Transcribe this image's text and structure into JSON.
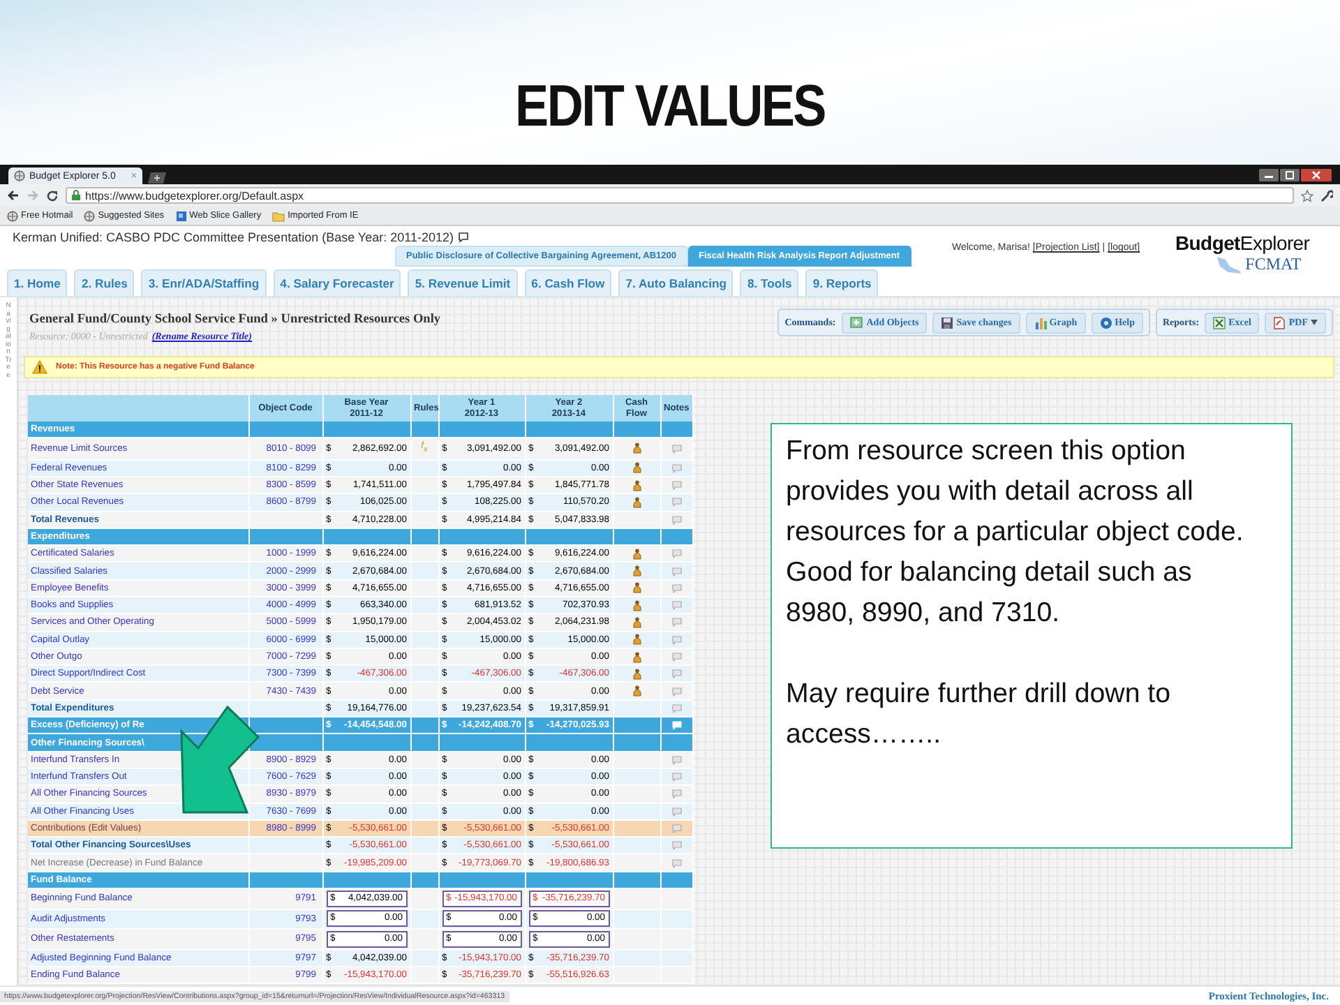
{
  "slide": {
    "title": "EDIT VALUES"
  },
  "browser": {
    "tab_title": "Budget Explorer 5.0",
    "tab_close": "×",
    "url": "https://www.budgetexplorer.org/Default.aspx",
    "bookmarks": [
      "Free Hotmail",
      "Suggested Sites",
      "Web Slice Gallery",
      "Imported From IE"
    ],
    "status_url": "https://www.budgetexplorer.org/Projection/ResView/Contributions.aspx?group_id=15&returnurl=/Projection/ResView/IndividualResource.aspx?id=463313"
  },
  "app": {
    "project_title": "Kerman Unified: CASBO PDC Committee Presentation (Base Year: 2011-2012)",
    "sub_tabs": [
      {
        "label": "Public Disclosure of Collective Bargaining Agreement, AB1200",
        "selected": false
      },
      {
        "label": "Fiscal Health Risk Analysis Report Adjustment",
        "selected": true
      }
    ],
    "welcome": "Welcome, Marisa!",
    "links": [
      "[Projection List]",
      "[logout]"
    ],
    "separator": "|",
    "logo": {
      "name": "**Budget**Explorer",
      "sub": "FCMAT"
    },
    "nav_tabs": [
      "1. Home",
      "2. Rules",
      "3. Enr/ADA/Staffing",
      "4. Salary Forecaster",
      "5. Revenue Limit",
      "6. Cash Flow",
      "7. Auto Balancing",
      "8. Tools",
      "9. Reports"
    ],
    "side_label": "Navigation Tree",
    "page_title": "General Fund/County School Service Fund » Unrestricted Resources Only",
    "resource": "Resource: 0000 - Unrestricted",
    "rename_link": "(Rename Resource Title)",
    "commands": {
      "label": "Commands:",
      "buttons": [
        {
          "label": "Add Objects"
        },
        {
          "label": "Save changes"
        },
        {
          "label": "Graph"
        },
        {
          "label": "Help"
        }
      ]
    },
    "reports": {
      "label": "Reports:",
      "buttons": [
        {
          "label": "Excel",
          "dropdown": false
        },
        {
          "label": "PDF",
          "dropdown": true
        }
      ]
    },
    "note": "Note: This Resource has a negative Fund Balance"
  },
  "table": {
    "columns": [
      "Object Code",
      "Base Year\n2011-12",
      "Rules",
      "Year 1\n2012-13",
      "Year 2\n2013-14",
      "Cash Flow",
      "Notes"
    ],
    "rows": [
      {
        "kind": "section",
        "label": "Revenues"
      },
      {
        "kind": "item",
        "label": "Revenue Limit Sources",
        "code": "8010 - 8099",
        "values": [
          [
            "$",
            "2,862,692.00"
          ],
          [
            "$",
            "3,091,492.00"
          ],
          [
            "$",
            "3,091,492.00"
          ]
        ],
        "red": [
          false,
          false,
          false
        ],
        "rule": "f$_{x}$",
        "cash_flow": true,
        "notes": true
      },
      {
        "kind": "item",
        "label": "Federal Revenues",
        "code": "8100 - 8299",
        "values": [
          [
            "$",
            "0.00"
          ],
          [
            "$",
            "0.00"
          ],
          [
            "$",
            "0.00"
          ]
        ],
        "red": [
          false,
          false,
          false
        ],
        "cash_flow": true,
        "notes": true
      },
      {
        "kind": "item",
        "label": "Other State Revenues",
        "code": "8300 - 8599",
        "values": [
          [
            "$",
            "1,741,511.00"
          ],
          [
            "$",
            "1,795,497.84"
          ],
          [
            "$",
            "1,845,771.78"
          ]
        ],
        "red": [
          false,
          false,
          false
        ],
        "cash_flow": true,
        "notes": true
      },
      {
        "kind": "item",
        "label": "Other Local Revenues",
        "code": "8600 - 8799",
        "values": [
          [
            "$",
            "106,025.00"
          ],
          [
            "$",
            "108,225.00"
          ],
          [
            "$",
            "110,570.20"
          ]
        ],
        "red": [
          false,
          false,
          false
        ],
        "cash_flow": true,
        "notes": true
      },
      {
        "kind": "total",
        "label": "Total Revenues",
        "values": [
          [
            "$",
            "4,710,228.00"
          ],
          [
            "$",
            "4,995,214.84"
          ],
          [
            "$",
            "5,047,833.98"
          ]
        ],
        "red": [
          false,
          false,
          false
        ],
        "cash_flow": false,
        "notes": true
      },
      {
        "kind": "section",
        "label": "Expenditures"
      },
      {
        "kind": "item",
        "label": "Certificated Salaries",
        "code": "1000 - 1999",
        "values": [
          [
            "$",
            "9,616,224.00"
          ],
          [
            "$",
            "9,616,224.00"
          ],
          [
            "$",
            "9,616,224.00"
          ]
        ],
        "red": [
          false,
          false,
          false
        ],
        "cash_flow": true,
        "notes": true
      },
      {
        "kind": "item",
        "label": "Classified Salaries",
        "code": "2000 - 2999",
        "values": [
          [
            "$",
            "2,670,684.00"
          ],
          [
            "$",
            "2,670,684.00"
          ],
          [
            "$",
            "2,670,684.00"
          ]
        ],
        "red": [
          false,
          false,
          false
        ],
        "cash_flow": true,
        "notes": true
      },
      {
        "kind": "item",
        "label": "Employee Benefits",
        "code": "3000 - 3999",
        "values": [
          [
            "$",
            "4,716,655.00"
          ],
          [
            "$",
            "4,716,655.00"
          ],
          [
            "$",
            "4,716,655.00"
          ]
        ],
        "red": [
          false,
          false,
          false
        ],
        "cash_flow": true,
        "notes": true
      },
      {
        "kind": "item",
        "label": "Books and Supplies",
        "code": "4000 - 4999",
        "values": [
          [
            "$",
            "663,340.00"
          ],
          [
            "$",
            "681,913.52"
          ],
          [
            "$",
            "702,370.93"
          ]
        ],
        "red": [
          false,
          false,
          false
        ],
        "cash_flow": true,
        "notes": true
      },
      {
        "kind": "item",
        "label": "Services and Other Operating",
        "code": "5000 - 5999",
        "values": [
          [
            "$",
            "1,950,179.00"
          ],
          [
            "$",
            "2,004,453.02"
          ],
          [
            "$",
            "2,064,231.98"
          ]
        ],
        "red": [
          false,
          false,
          false
        ],
        "cash_flow": true,
        "notes": true
      },
      {
        "kind": "item",
        "label": "Capital Outlay",
        "code": "6000 - 6999",
        "values": [
          [
            "$",
            "15,000.00"
          ],
          [
            "$",
            "15,000.00"
          ],
          [
            "$",
            "15,000.00"
          ]
        ],
        "red": [
          false,
          false,
          false
        ],
        "cash_flow": true,
        "notes": true
      },
      {
        "kind": "item",
        "label": "Other Outgo",
        "code": "7000 - 7299",
        "values": [
          [
            "$",
            "0.00"
          ],
          [
            "$",
            "0.00"
          ],
          [
            "$",
            "0.00"
          ]
        ],
        "red": [
          false,
          false,
          false
        ],
        "cash_flow": true,
        "notes": true
      },
      {
        "kind": "item",
        "label": "Direct Support/Indirect Cost",
        "code": "7300 - 7399",
        "values": [
          [
            "$",
            "-467,306.00"
          ],
          [
            "$",
            "-467,306.00"
          ],
          [
            "$",
            "-467,306.00"
          ]
        ],
        "red": [
          true,
          true,
          true
        ],
        "cash_flow": true,
        "notes": true
      },
      {
        "kind": "item",
        "label": "Debt Service",
        "code": "7430 - 7439",
        "values": [
          [
            "$",
            "0.00"
          ],
          [
            "$",
            "0.00"
          ],
          [
            "$",
            "0.00"
          ]
        ],
        "red": [
          false,
          false,
          false
        ],
        "cash_flow": true,
        "notes": true
      },
      {
        "kind": "total",
        "label": "Total Expenditures",
        "values": [
          [
            "$",
            "19,164,776.00"
          ],
          [
            "$",
            "19,237,623.54"
          ],
          [
            "$",
            "19,317,859.91"
          ]
        ],
        "red": [
          false,
          false,
          false
        ],
        "cash_flow": false,
        "notes": true
      },
      {
        "kind": "excess",
        "label": "Excess (Deficiency) of Re",
        "values": [
          [
            "$",
            "-14,454,548.00"
          ],
          [
            "$",
            "-14,242,408.70"
          ],
          [
            "$",
            "-14,270,025.93"
          ]
        ],
        "cash_flow": false,
        "notes": true
      },
      {
        "kind": "section",
        "label": "Other Financing Sources\\"
      },
      {
        "kind": "item",
        "label": "Interfund Transfers In",
        "code": "8900 - 8929",
        "values": [
          [
            "$",
            "0.00"
          ],
          [
            "$",
            "0.00"
          ],
          [
            "$",
            "0.00"
          ]
        ],
        "red": [
          false,
          false,
          false
        ],
        "cash_flow": false,
        "notes": true
      },
      {
        "kind": "item",
        "label": "Interfund Transfers Out",
        "code": "7600 - 7629",
        "values": [
          [
            "$",
            "0.00"
          ],
          [
            "$",
            "0.00"
          ],
          [
            "$",
            "0.00"
          ]
        ],
        "red": [
          false,
          false,
          false
        ],
        "cash_flow": false,
        "notes": true
      },
      {
        "kind": "item",
        "label": "All Other Financing Sources",
        "code": "8930 - 8979",
        "values": [
          [
            "$",
            "0.00"
          ],
          [
            "$",
            "0.00"
          ],
          [
            "$",
            "0.00"
          ]
        ],
        "red": [
          false,
          false,
          false
        ],
        "cash_flow": false,
        "notes": true
      },
      {
        "kind": "item",
        "label": "All Other Financing Uses",
        "code": "7630 - 7699",
        "values": [
          [
            "$",
            "0.00"
          ],
          [
            "$",
            "0.00"
          ],
          [
            "$",
            "0.00"
          ]
        ],
        "red": [
          false,
          false,
          false
        ],
        "cash_flow": false,
        "notes": true
      },
      {
        "kind": "highlight",
        "label": "Contributions (Edit Values)",
        "code": "8980 - 8999",
        "values": [
          [
            "$",
            "-5,530,661.00"
          ],
          [
            "$",
            "-5,530,661.00"
          ],
          [
            "$",
            "-5,530,661.00"
          ]
        ],
        "red": [
          true,
          true,
          true
        ],
        "cash_flow": false,
        "notes": true
      },
      {
        "kind": "total",
        "label": "Total Other Financing Sources\\Uses",
        "values": [
          [
            "$",
            "-5,530,661.00"
          ],
          [
            "$",
            "-5,530,661.00"
          ],
          [
            "$",
            "-5,530,661.00"
          ]
        ],
        "red": [
          true,
          true,
          true
        ],
        "cash_flow": false,
        "notes": true
      },
      {
        "kind": "net",
        "label": "Net Increase (Decrease) in Fund Balance",
        "values": [
          [
            "$",
            "-19,985,209.00"
          ],
          [
            "$",
            "-19,773,069.70"
          ],
          [
            "$",
            "-19,800,686.93"
          ]
        ],
        "red": [
          true,
          true,
          true
        ],
        "cash_flow": false,
        "notes": true
      },
      {
        "kind": "section",
        "label": "Fund Balance"
      },
      {
        "kind": "input",
        "label": "Beginning Fund Balance",
        "code": "9791",
        "values": [
          [
            "$",
            "4,042,039.00"
          ],
          [
            "$",
            "-15,943,170.00"
          ],
          [
            "$",
            "-35,716,239.70"
          ]
        ],
        "red": [
          false,
          true,
          true
        ],
        "cash_flow": false,
        "notes": false
      },
      {
        "kind": "input",
        "label": "Audit Adjustments",
        "code": "9793",
        "values": [
          [
            "$",
            "0.00"
          ],
          [
            "$",
            "0.00"
          ],
          [
            "$",
            "0.00"
          ]
        ],
        "red": [
          false,
          false,
          false
        ],
        "cash_flow": false,
        "notes": false
      },
      {
        "kind": "input",
        "label": "Other Restatements",
        "code": "9795",
        "values": [
          [
            "$",
            "0.00"
          ],
          [
            "$",
            "0.00"
          ],
          [
            "$",
            "0.00"
          ]
        ],
        "red": [
          false,
          false,
          false
        ],
        "cash_flow": false,
        "notes": false
      },
      {
        "kind": "item",
        "label": "Adjusted Beginning Fund Balance",
        "code": "9797",
        "values": [
          [
            "$",
            "4,042,039.00"
          ],
          [
            "$",
            "-15,943,170.00"
          ],
          [
            "$",
            "-35,716,239.70"
          ]
        ],
        "red": [
          false,
          true,
          true
        ],
        "cash_flow": false,
        "notes": false
      },
      {
        "kind": "item",
        "label": "Ending Fund Balance",
        "code": "9799",
        "values": [
          [
            "$",
            "-15,943,170.00"
          ],
          [
            "$",
            "-35,716,239.70"
          ],
          [
            "$",
            "-55,516,926.63"
          ]
        ],
        "red": [
          true,
          true,
          true
        ],
        "cash_flow": false,
        "notes": false
      }
    ]
  },
  "callout": {
    "paragraphs": [
      "From resource screen this option provides you with detail across all resources for a particular object code.  Good for balancing detail such as 8980, 8990, and 7310.",
      "May require further drill down to access…….."
    ]
  },
  "footer": "Proxient Technologies, Inc."
}
